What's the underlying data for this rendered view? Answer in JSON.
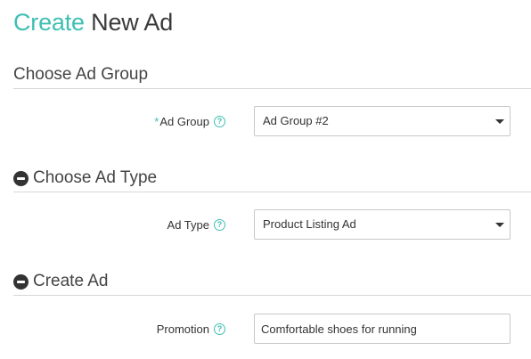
{
  "page": {
    "title_accent": "Create",
    "title_rest": "New Ad"
  },
  "sections": {
    "ad_group": {
      "title": "Choose Ad Group",
      "field_label": "Ad Group",
      "required_mark": "*",
      "selected": "Ad Group #2"
    },
    "ad_type": {
      "title": "Choose Ad Type",
      "field_label": "Ad Type",
      "selected": "Product Listing Ad"
    },
    "create_ad": {
      "title": "Create Ad",
      "field_label": "Promotion",
      "value": "Comfortable shoes for running"
    }
  },
  "icons": {
    "help": "question-mark",
    "collapse": "minus-circle",
    "dropdown": "caret-down"
  },
  "colors": {
    "accent": "#3fbfb3",
    "text": "#333333",
    "divider": "#d6d6d6"
  }
}
